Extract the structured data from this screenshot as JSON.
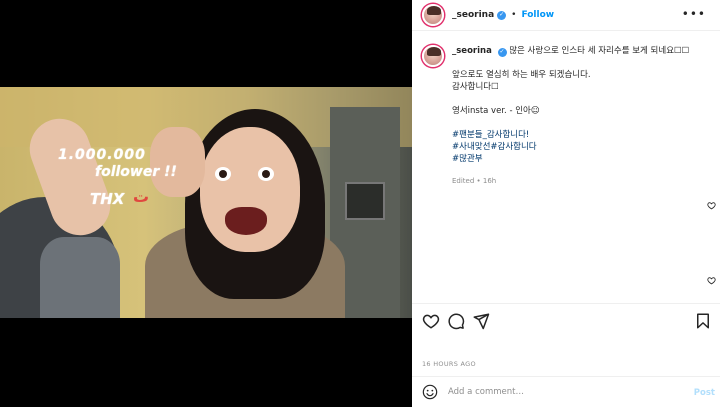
{
  "post": {
    "username": "_seorina",
    "follow_label": "Follow",
    "dot_separator": "•",
    "more_label": "•••"
  },
  "media": {
    "overlay_text": {
      "line1": "1.000.000",
      "line2": "follower !!",
      "line3": "THX",
      "smiley": "ت"
    }
  },
  "caption": {
    "username": "_seorina",
    "lines": [
      "많은 사랑으로 인스타 세 자리수를 보게 되네요☐☐",
      "앞으로도 열심히 하는 배우 되겠습니다.",
      "감사합니다☐",
      "영서insta ver. - 인아☺"
    ],
    "hashtags": [
      "#팬분들_감사합니다!",
      "#사내맞선#감사합니다",
      "#많관부"
    ],
    "edited": "Edited • 16h"
  },
  "footer": {
    "timestamp": "16 HOURS AGO",
    "comment_placeholder": "Add a comment…",
    "post_label": "Post"
  },
  "colors": {
    "accent": "#0095f6",
    "verified": "#3897f0",
    "hashtag": "#00376b",
    "post_disabled": "#b2dffc"
  }
}
